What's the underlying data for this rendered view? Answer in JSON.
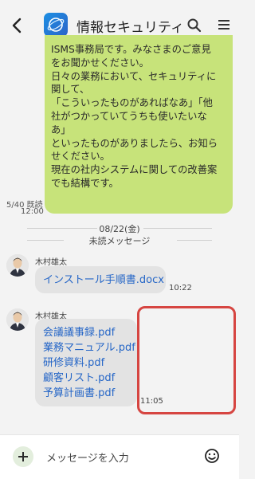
{
  "header": {
    "title": "情報セキュリティ…"
  },
  "message": {
    "lines": [
      "ISMS事務局です。みなさまのご意見",
      "をお聞かせください。",
      "日々の業務において、セキュリティに",
      "関して、",
      "「こういったものがあればなあ」「他",
      "社がつかっていてうちも使いたいな",
      "あ」",
      "といったものがありましたら、お知ら",
      "せください。",
      "現在の社内システムに関しての改善案",
      "でも結構です。"
    ],
    "read_status": "5/40 既読",
    "time": "12:00"
  },
  "date_separator": {
    "date": "08/22(金)",
    "unread": "未読メッセージ"
  },
  "messages": [
    {
      "sender": "木村雄太",
      "files": [
        "インストール手順書.docx"
      ],
      "time": "10:22"
    },
    {
      "sender": "木村雄太",
      "files": [
        "会議議事録.pdf",
        "業務マニュアル.pdf",
        "研修資料.pdf",
        "顧客リスト.pdf",
        "予算計画書.pdf"
      ],
      "time": "11:05"
    }
  ],
  "input": {
    "placeholder": "メッセージを入力"
  },
  "colors": {
    "own_bubble": "#c7e37a",
    "other_bubble": "#e3e3e3",
    "link": "#2566c7",
    "highlight": "#d64541"
  }
}
